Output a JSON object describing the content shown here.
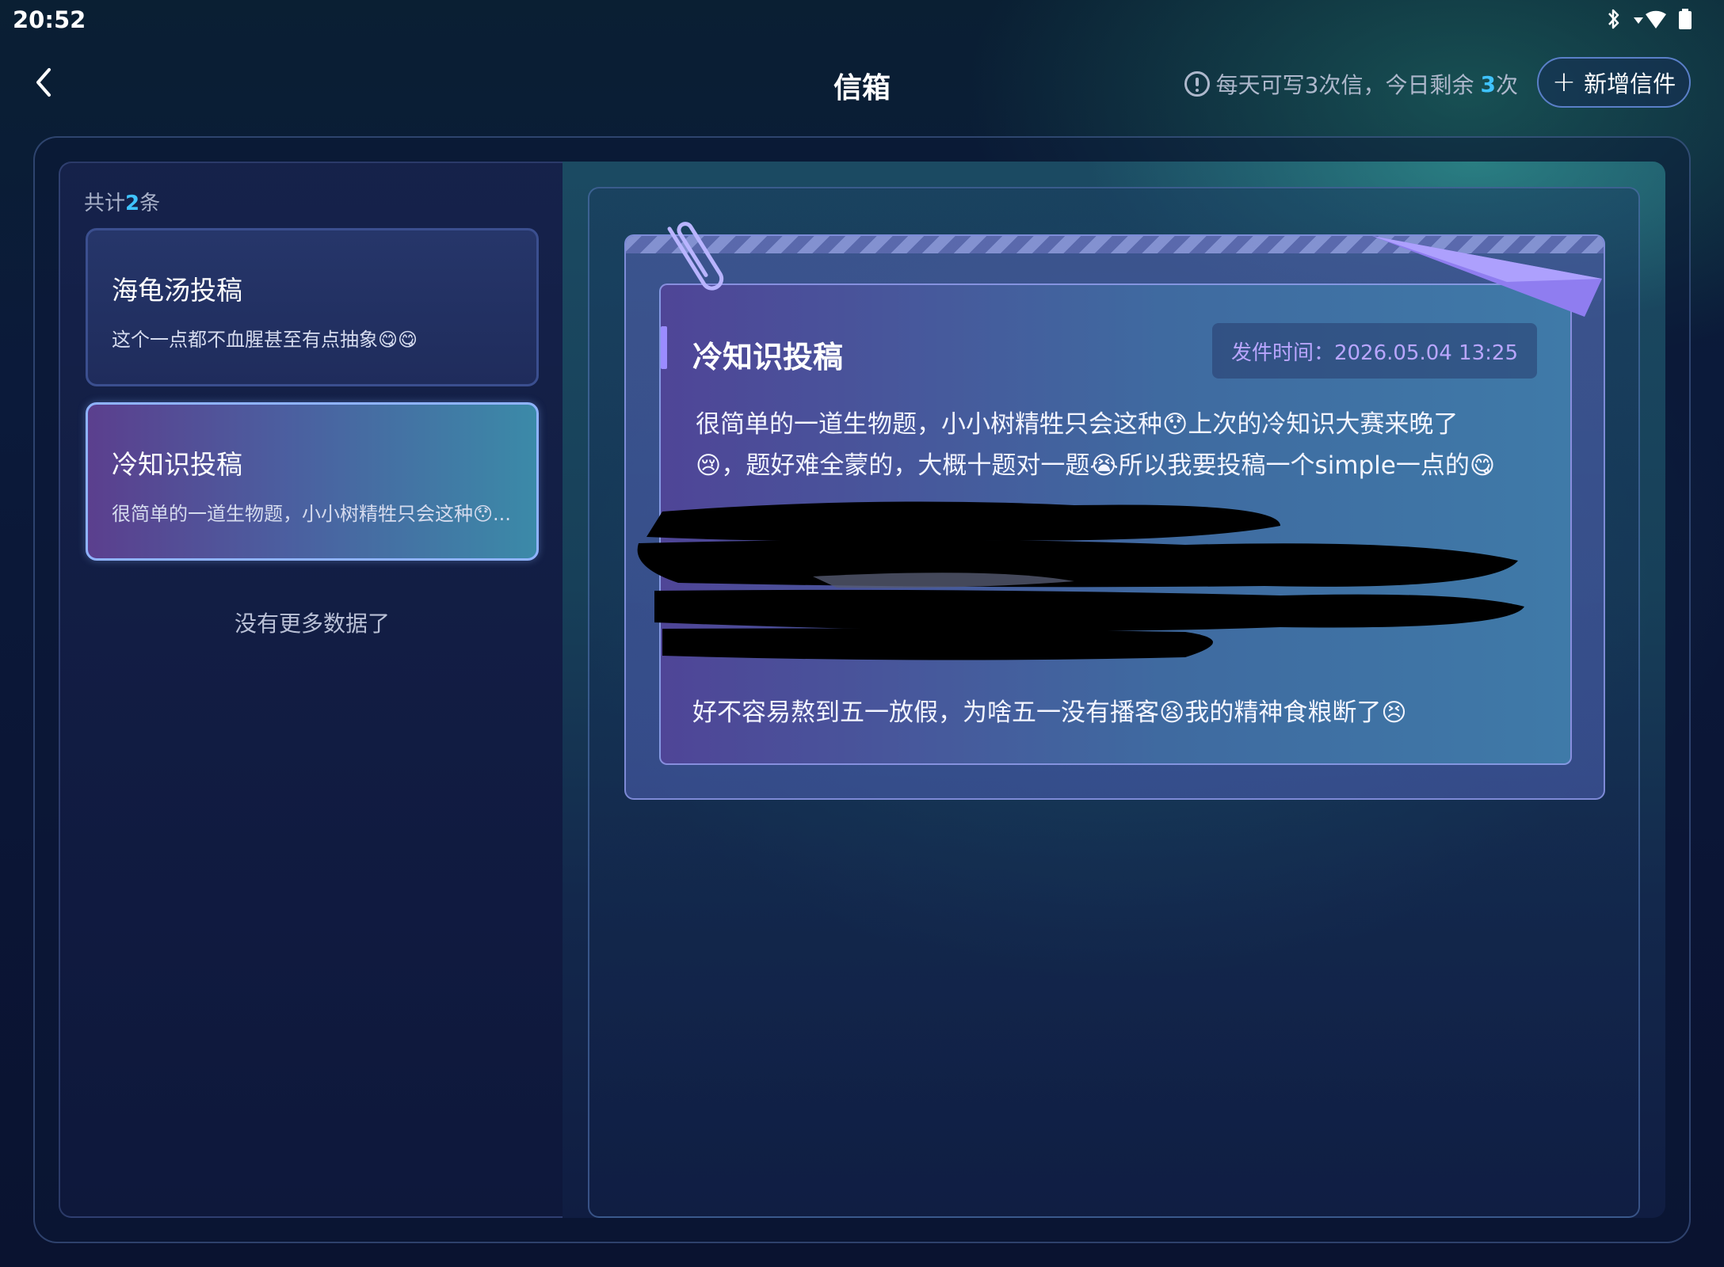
{
  "status_bar": {
    "time": "20:52"
  },
  "header": {
    "title": "信箱",
    "quota_prefix": "每天可写3次信，今日剩余",
    "quota_remaining": "3",
    "quota_suffix": "次",
    "new_button_label": "新增信件"
  },
  "list": {
    "count_prefix": "共计",
    "count": "2",
    "count_suffix": "条",
    "items": [
      {
        "title": "海龟汤投稿",
        "preview": "这个一点都不血腥甚至有点抽象😋😋"
      },
      {
        "title": "冷知识投稿",
        "preview": "很简单的一道生物题，小小树精牲只会这种😯..."
      }
    ],
    "end_text": "没有更多数据了"
  },
  "letter": {
    "title": "冷知识投稿",
    "date_label": "发件时间：2026.05.04 13:25",
    "body_line1": "很简单的一道生物题，小小树精牲只会这种😯上次的冷知识大赛来晚了",
    "body_line2": "😢，题好难全蒙的，大概十题对一题😭所以我要投稿一个simple一点的😋",
    "last_line": "好不容易熬到五一放假，为啥五一没有播客😫我的精神食粮断了😣"
  }
}
